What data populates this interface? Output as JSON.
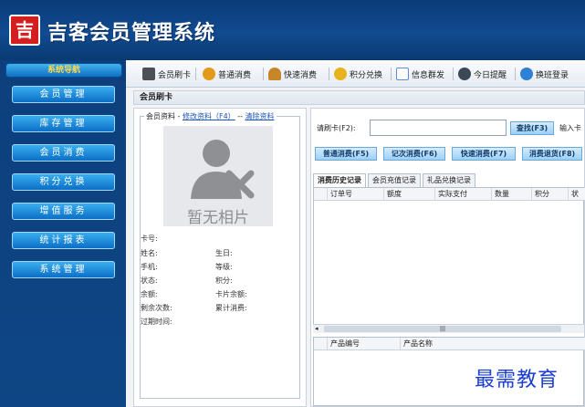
{
  "app": {
    "logo_char": "吉",
    "title": "吉客会员管理系统"
  },
  "sidebar": {
    "header": "系统导航",
    "items": [
      "会员管理",
      "库存管理",
      "会员消费",
      "积分兑换",
      "增值服务",
      "统计报表",
      "系统管理"
    ]
  },
  "toolbar": {
    "items": [
      {
        "label": "会员刷卡",
        "icon": "card-reader-icon",
        "color": "#4a4f58"
      },
      {
        "label": "普通消费",
        "icon": "money-bag-icon",
        "color": "#e39a1b"
      },
      {
        "label": "快速消费",
        "icon": "people-icon",
        "color": "#c8862a"
      },
      {
        "label": "积分兑换",
        "icon": "gift-icon",
        "color": "#e8b21c"
      },
      {
        "label": "信息群发",
        "icon": "mail-icon",
        "color": "#5b8fd1"
      },
      {
        "label": "今日提醒",
        "icon": "clock-icon",
        "color": "#3d4856"
      },
      {
        "label": "换班登录",
        "icon": "swap-icon",
        "color": "#2f7fd6"
      }
    ]
  },
  "section": {
    "title": "会员刷卡"
  },
  "profile": {
    "legend_text": "会员资料 -",
    "edit_link": "修改资料（F4）",
    "dash": "--",
    "clear_link": "清除资料",
    "photo_text": "暂无相片",
    "fields": {
      "card_no": "卡号:",
      "name": "姓名:",
      "birthday": "生日:",
      "phone": "手机:",
      "level": "等级:",
      "status": "状态:",
      "points": "积分:",
      "balance": "余额:",
      "card_fee": "卡片余额:",
      "remaining": "剩余次数:",
      "total": "累计消费:",
      "expire": "过期时间:"
    }
  },
  "consume": {
    "card_label": "请刷卡(F2):",
    "card_value": "",
    "search_button": "查找(F3)",
    "tail_label": "输入卡",
    "buttons": [
      "普通消费(F5)",
      "记次消费(F6)",
      "快速消费(F7)",
      "消费退货(F8)"
    ],
    "tabs": [
      "消费历史记录",
      "会员充值记录",
      "礼品兑换记录"
    ],
    "columns": [
      "订单号",
      "额度",
      "实际支付",
      "数量",
      "积分",
      "状"
    ],
    "scroll_mark": "|||",
    "columns2": [
      "产品编号",
      "产品名称"
    ]
  },
  "watermark": "最需教育"
}
